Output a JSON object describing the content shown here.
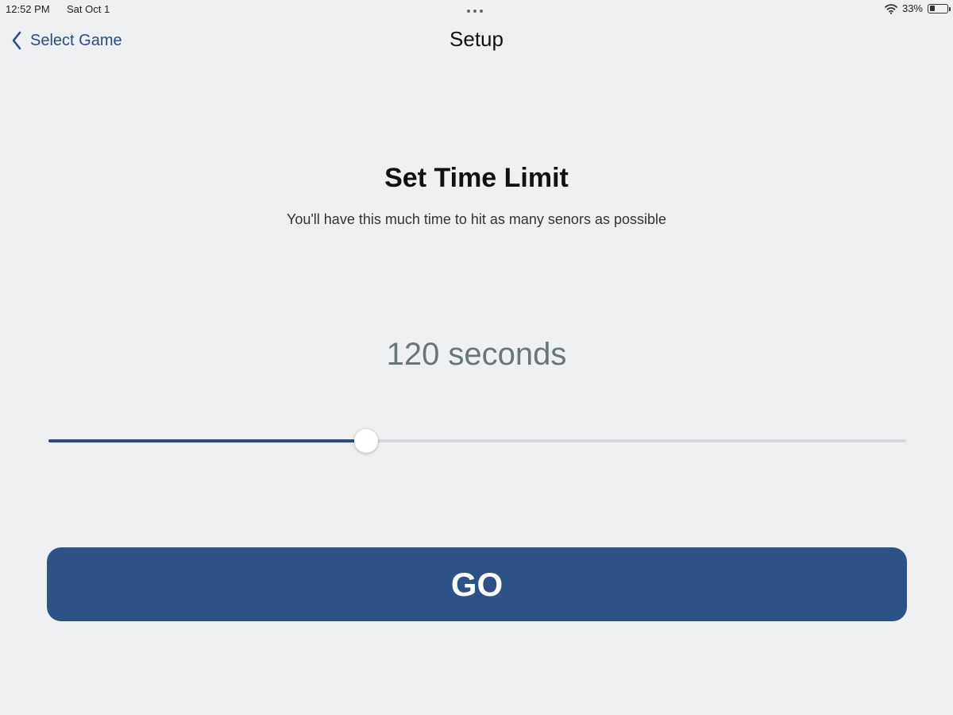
{
  "status_bar": {
    "time": "12:52 PM",
    "date": "Sat Oct 1",
    "battery_percent": "33%",
    "battery_level": 0.33,
    "wifi_icon": "wifi-icon"
  },
  "nav": {
    "back_label": "Select Game",
    "back_icon": "chevron-left-icon",
    "title": "Setup"
  },
  "content": {
    "heading": "Set Time Limit",
    "subtitle": "You'll have this much time to hit as many senors as possible",
    "value_label": "120 seconds",
    "slider_fraction": 0.37
  },
  "actions": {
    "go_label": "GO"
  },
  "colors": {
    "accent": "#2b4a8a",
    "button": "#2d5287",
    "background": "#eff0f2",
    "track": "#d6d8dc"
  }
}
